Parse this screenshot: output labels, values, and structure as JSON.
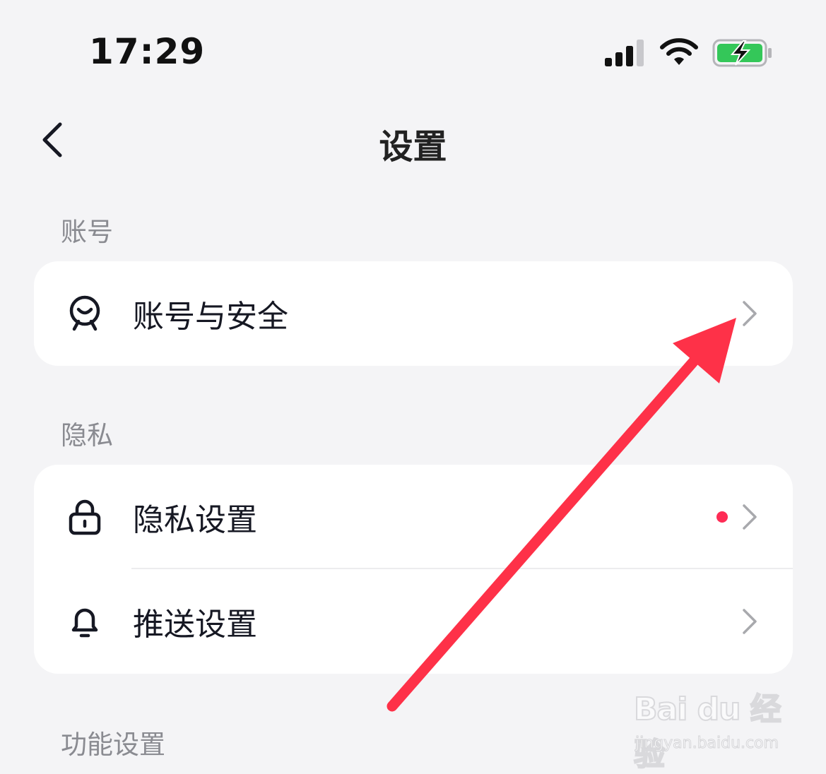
{
  "status_bar": {
    "time": "17:29",
    "signal_icon": "cellular-signal-icon",
    "wifi_icon": "wifi-icon",
    "battery_icon": "battery-charging-icon",
    "battery_color": "#34c759"
  },
  "nav": {
    "back_icon": "chevron-left-icon",
    "title": "设置"
  },
  "sections": {
    "account": {
      "label": "账号",
      "items": [
        {
          "label": "账号与安全",
          "icon": "account-face-icon",
          "chevron_icon": "chevron-right-icon"
        }
      ]
    },
    "privacy": {
      "label": "隐私",
      "items": [
        {
          "label": "隐私设置",
          "icon": "lock-icon",
          "has_notification_dot": true,
          "chevron_icon": "chevron-right-icon"
        },
        {
          "label": "推送设置",
          "icon": "bell-icon",
          "chevron_icon": "chevron-right-icon"
        }
      ]
    },
    "features": {
      "label": "功能设置"
    }
  },
  "annotation": {
    "arrow_color": "#fe3148"
  },
  "watermark": {
    "brand": "Bai du 经验",
    "url": "jingyan.baidu.com"
  },
  "colors": {
    "background": "#f4f4f6",
    "card": "#ffffff",
    "notification_dot": "#fe2c55",
    "secondary_text": "#8a8b91"
  }
}
